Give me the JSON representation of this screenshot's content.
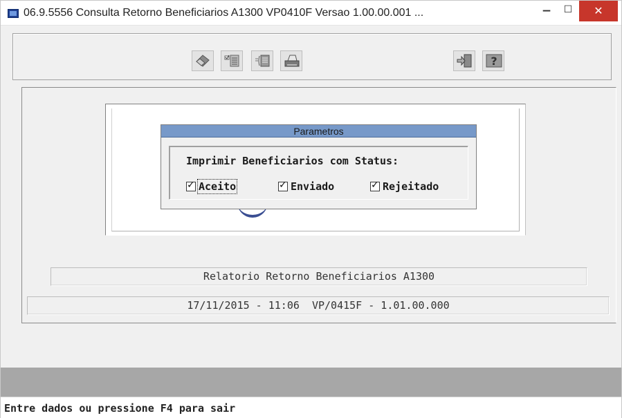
{
  "window": {
    "title": "06.9.5556 Consulta Retorno Beneficiarios A1300 VP0410F Versao 1.00.00.001 ...",
    "controls": {
      "minimize": "−",
      "maximize": "☐",
      "close": "✕"
    }
  },
  "toolbar": {
    "buttons": [
      {
        "icon": "eraser-icon"
      },
      {
        "icon": "checklist-icon"
      },
      {
        "icon": "list-arrow-icon"
      },
      {
        "icon": "printer-icon"
      },
      {
        "icon": "exit-door-icon"
      },
      {
        "icon": "help-icon"
      }
    ]
  },
  "dialog": {
    "title": "Parametros",
    "group_label": "Imprimir Beneficiarios com Status:",
    "checkboxes": [
      {
        "label": "Aceito",
        "checked": true
      },
      {
        "label": "Enviado",
        "checked": true
      },
      {
        "label": "Rejeitado",
        "checked": true
      }
    ]
  },
  "report": {
    "name": "Relatorio Retorno Beneficiarios A1300",
    "info": "17/11/2015 - 11:06  VP/0415F - 1.01.00.000"
  },
  "status_bar": {
    "text": "Entre dados ou pressione F4 para sair"
  },
  "colors": {
    "dialog_title_bg": "#7799c9",
    "close_button": "#c7362b",
    "status_gray": "#a7a7a7"
  }
}
